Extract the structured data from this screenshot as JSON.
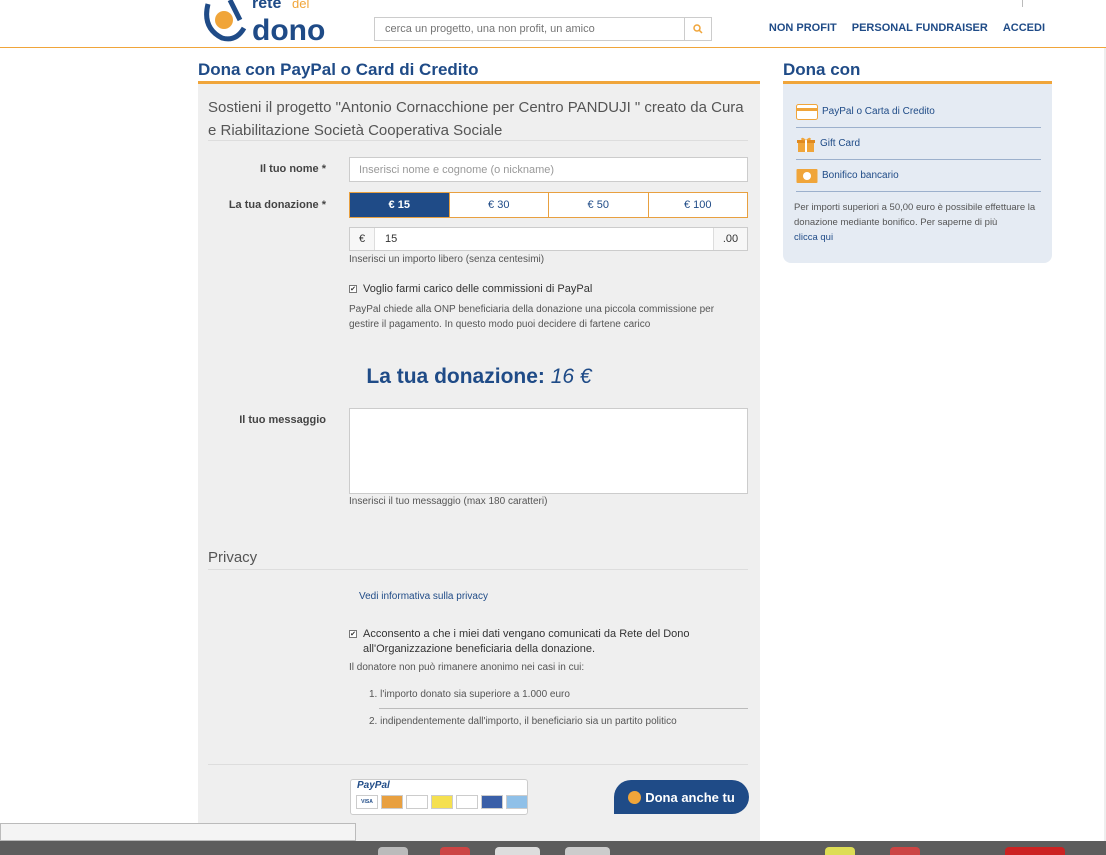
{
  "header": {
    "search_placeholder": "cerca un progetto, una non profit, un amico",
    "nav": [
      "NON PROFIT",
      "PERSONAL FUNDRAISER",
      "ACCEDI"
    ]
  },
  "main": {
    "title": "Dona con PayPal o Card di Credito",
    "intro": "Sostieni il progetto \"Antonio Cornacchione per Centro PANDUJI \" creato da Cura e Riabilitazione Società Cooperativa Sociale",
    "name_label": "Il tuo nome *",
    "name_placeholder": "Inserisci nome e cognome (o nickname)",
    "donation_label": "La tua donazione *",
    "amounts": [
      "€ 15",
      "€ 30",
      "€ 50",
      "€ 100"
    ],
    "selected_amount_index": 0,
    "currency": "€",
    "amount_value": "15",
    "decimals": ".00",
    "amount_help": "Inserisci un importo libero (senza centesimi)",
    "fee_checkbox": "Voglio farmi carico delle commissioni di PayPal",
    "fee_checked": true,
    "fee_help": "PayPal chiede alla ONP beneficiaria della donazione una piccola commissione per gestire il pagamento. In questo modo puoi decidere di fartene carico",
    "total_label": "La tua donazione:",
    "total_value": "16 €",
    "message_label": "Il tuo messaggio",
    "message_help": "Inserisci il tuo messaggio (max 180 caratteri)",
    "privacy_title": "Privacy",
    "privacy_link": "Vedi informativa sulla privacy",
    "consent_text": "Acconsento a che i miei dati vengano comunicati da Rete del Dono all'Organizzazione beneficiaria della donazione.",
    "consent_checked": true,
    "anon_note": "Il donatore non può rimanere anonimo nei casi in cui:",
    "anon_cases": [
      "1. l'importo donato sia superiore a 1.000 euro",
      "2. indipendentemente dall'importo, il beneficiario sia un partito politico"
    ],
    "paypal_logo": "PayPal",
    "donate_button": "Dona anche tu"
  },
  "sidebar": {
    "title": "Dona con",
    "items": [
      {
        "label": "PayPal o Carta di Credito",
        "icon": "credit-card-icon",
        "color": "#f0a53a"
      },
      {
        "label": "Gift Card",
        "icon": "gift-icon",
        "color": "#f0a53a"
      },
      {
        "label": "Bonifico bancario",
        "icon": "banknote-icon",
        "color": "#f0a53a"
      }
    ],
    "note": "Per importi superiori a 50,00 euro è possibile effettuare la donazione mediante bonifico. Per saperne di più",
    "note_link": "clicca qui"
  },
  "colors": {
    "brand_blue": "#1f4b87",
    "accent_orange": "#f0a53a"
  }
}
